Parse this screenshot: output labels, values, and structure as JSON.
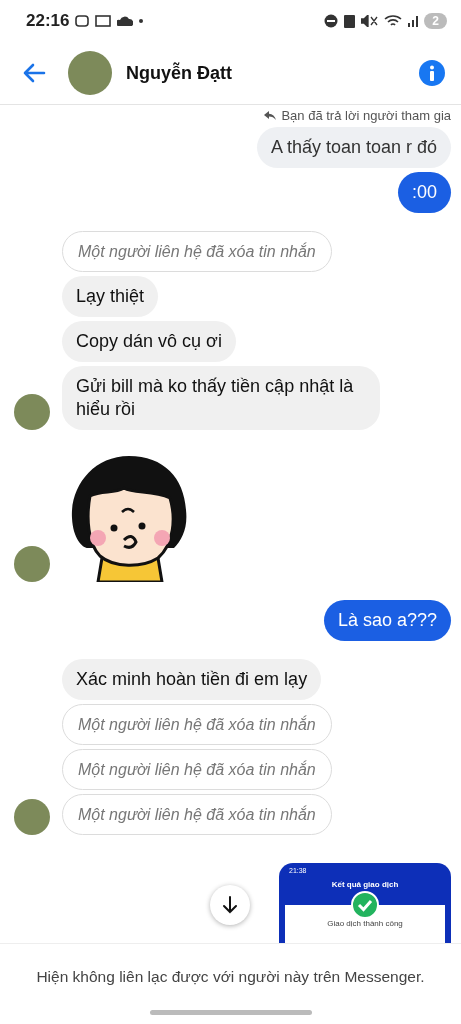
{
  "status_bar": {
    "time": "22:16",
    "battery": "2"
  },
  "header": {
    "name": "Nguyễn Đạtt"
  },
  "messages": [
    {
      "kind": "reply_note",
      "text": "Bạn đã trả lời người tham gia",
      "avatar": false
    },
    {
      "kind": "quoted",
      "text": "A thấy toan toan r đó",
      "avatar": false
    },
    {
      "kind": "outgoing",
      "text": ":00",
      "avatar": false
    },
    {
      "kind": "deleted",
      "text": "Một người liên hệ đã xóa tin nhắn",
      "avatar": false
    },
    {
      "kind": "incoming",
      "text": "Lạy thiệt",
      "avatar": false
    },
    {
      "kind": "incoming",
      "text": "Copy dán vô cụ ơi",
      "avatar": false
    },
    {
      "kind": "incoming",
      "text": "Gửi bill mà ko thấy tiền cập nhật là hiểu rồi",
      "avatar": true
    },
    {
      "kind": "sticker",
      "avatar": true
    },
    {
      "kind": "outgoing",
      "text": "Là sao a???",
      "avatar": false
    },
    {
      "kind": "incoming",
      "text": "Xác minh hoàn tiền đi em lạy",
      "avatar": false
    },
    {
      "kind": "deleted",
      "text": "Một người liên hệ đã xóa tin nhắn",
      "avatar": false
    },
    {
      "kind": "deleted",
      "text": "Một người liên hệ đã xóa tin nhắn",
      "avatar": false
    },
    {
      "kind": "deleted",
      "text": "Một người liên hệ đã xóa tin nhắn",
      "avatar": true
    },
    {
      "kind": "image",
      "time": "21:38",
      "title": "Kết quả giao dịch",
      "caption": "Giao dịch thành công",
      "avatar": false
    }
  ],
  "footer": {
    "notice": "Hiện không liên lạc được với người này trên Messenger."
  }
}
